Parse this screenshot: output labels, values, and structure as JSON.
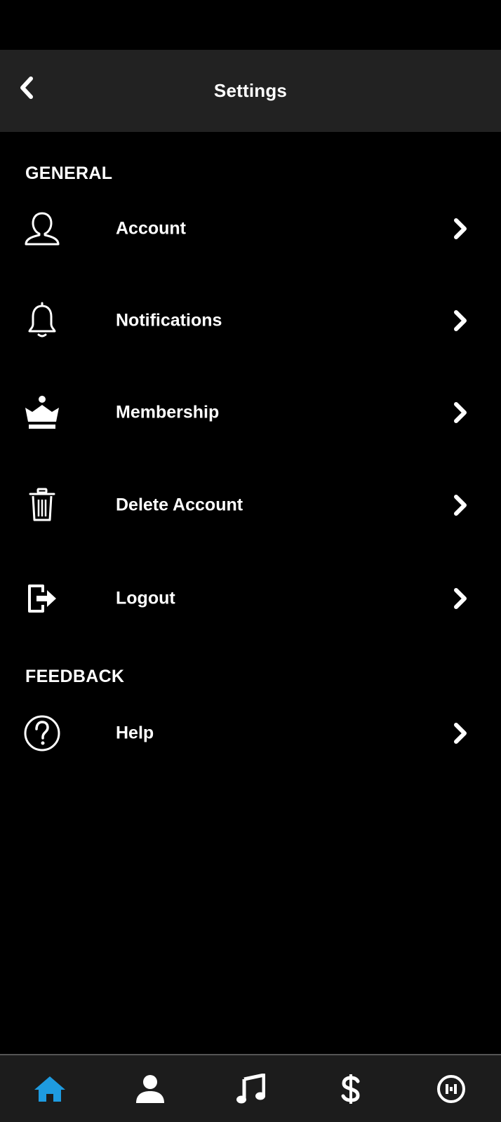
{
  "header": {
    "title": "Settings",
    "back_icon": "chevron-left-icon"
  },
  "sections": [
    {
      "heading": "GENERAL",
      "items": [
        {
          "label": "Account",
          "icon": "user-outline-icon"
        },
        {
          "label": "Notifications",
          "icon": "bell-icon"
        },
        {
          "label": "Membership",
          "icon": "crown-icon"
        },
        {
          "label": "Delete Account",
          "icon": "trash-icon"
        },
        {
          "label": "Logout",
          "icon": "logout-icon"
        }
      ]
    },
    {
      "heading": "FEEDBACK",
      "items": [
        {
          "label": "Help",
          "icon": "question-circle-icon"
        }
      ]
    }
  ],
  "bottom_nav": {
    "items": [
      {
        "icon": "home-icon",
        "active": true
      },
      {
        "icon": "profile-icon",
        "active": false
      },
      {
        "icon": "music-note-icon",
        "active": false
      },
      {
        "icon": "dollar-icon",
        "active": false
      },
      {
        "icon": "stats-circle-icon",
        "active": false
      }
    ]
  },
  "colors": {
    "background": "#000000",
    "header_bg": "#222222",
    "nav_bg": "#1c1c1c",
    "accent": "#1e9be0",
    "text": "#ffffff"
  }
}
